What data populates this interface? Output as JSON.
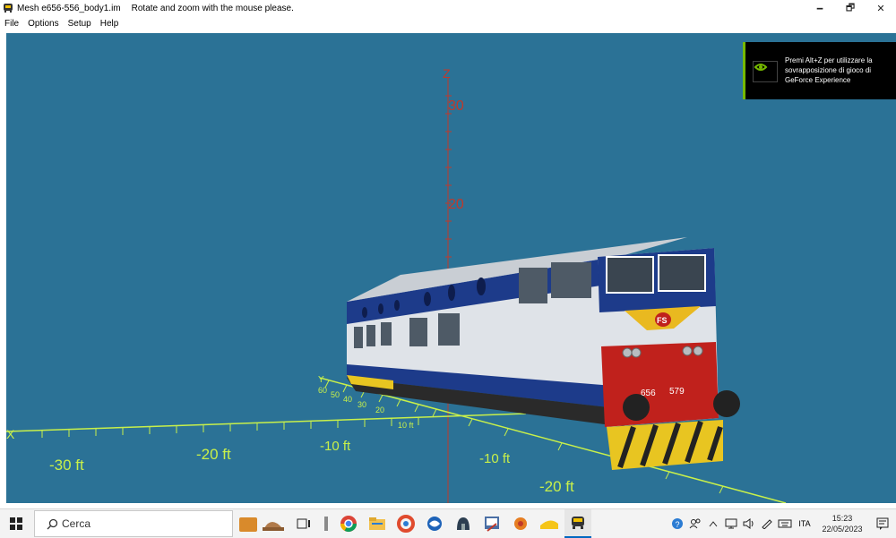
{
  "window": {
    "title": "Mesh e656-556_body1.im",
    "hint": "Rotate and zoom with the mouse please.",
    "minimize": "🗕",
    "restore": "🗗",
    "close": "✕"
  },
  "menu": {
    "items": [
      "File",
      "Options",
      "Setup",
      "Help"
    ]
  },
  "viewport": {
    "background": "#2b7296",
    "z_axis_label": "Z",
    "x_axis_label": "X",
    "y_axis_label": "Y",
    "z_ticks": [
      "30",
      "20"
    ],
    "x_ticks": [
      "-30 ft",
      "-20 ft",
      "-10 ft"
    ],
    "y_ticks": [
      "-10 ft",
      "-20 ft"
    ],
    "back_ticks": [
      "60",
      "50",
      "40",
      "30",
      "20",
      "10 ft"
    ],
    "loco_numbers": [
      "656",
      "579"
    ],
    "logo_text": "FS"
  },
  "notification": {
    "text": "Premi Alt+Z per utilizzare la\nsovrapposizione di gioco di\nGeForce Experience",
    "accent": "#76b900"
  },
  "taskbar": {
    "search_placeholder": "Cerca",
    "language": "ITA",
    "time": "15:23",
    "date": "22/05/2023"
  }
}
